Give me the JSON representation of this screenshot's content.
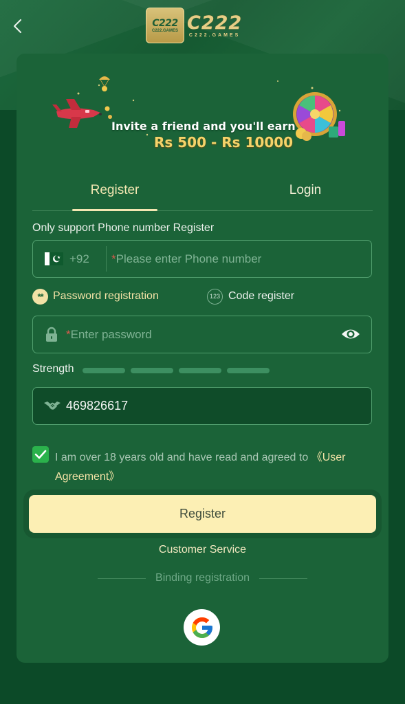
{
  "header": {
    "back_icon": "chevron-left-icon",
    "logo_badge": "C222",
    "logo_badge_sub": "C222.GAMES",
    "logo_wordmark": "C222",
    "logo_wordmark_sub": "C222.GAMES"
  },
  "banner": {
    "line1": "Invite a friend and you'll earn",
    "line2": "Rs 500 - Rs 10000"
  },
  "tabs": [
    {
      "label": "Register",
      "active": true
    },
    {
      "label": "Login",
      "active": false
    }
  ],
  "form": {
    "hint": "Only support Phone number Register",
    "country_code": "+92",
    "required_mark": "*",
    "phone_placeholder": "Please enter Phone number",
    "modes": {
      "password": {
        "label": "Password registration",
        "icon_text": "**",
        "selected": true
      },
      "code": {
        "label": "Code register",
        "icon_text": "123",
        "selected": false
      }
    },
    "password_placeholder": "Enter password",
    "strength_label": "Strength",
    "strength_level": 0,
    "invite_code": "469826617",
    "agree_text": "I am over 18 years old and have read and agreed to ",
    "agree_link": "《User Agreement》",
    "agree_checked": true,
    "register_button": "Register"
  },
  "footer": {
    "customer_service": "Customer Service",
    "binding_label": "Binding registration",
    "google_icon": "google-icon"
  },
  "colors": {
    "background": "#0c4a28",
    "card": "#1b6338",
    "accent": "#f3e7b2",
    "button": "#fcefb4",
    "checkbox": "#2bb24c"
  }
}
